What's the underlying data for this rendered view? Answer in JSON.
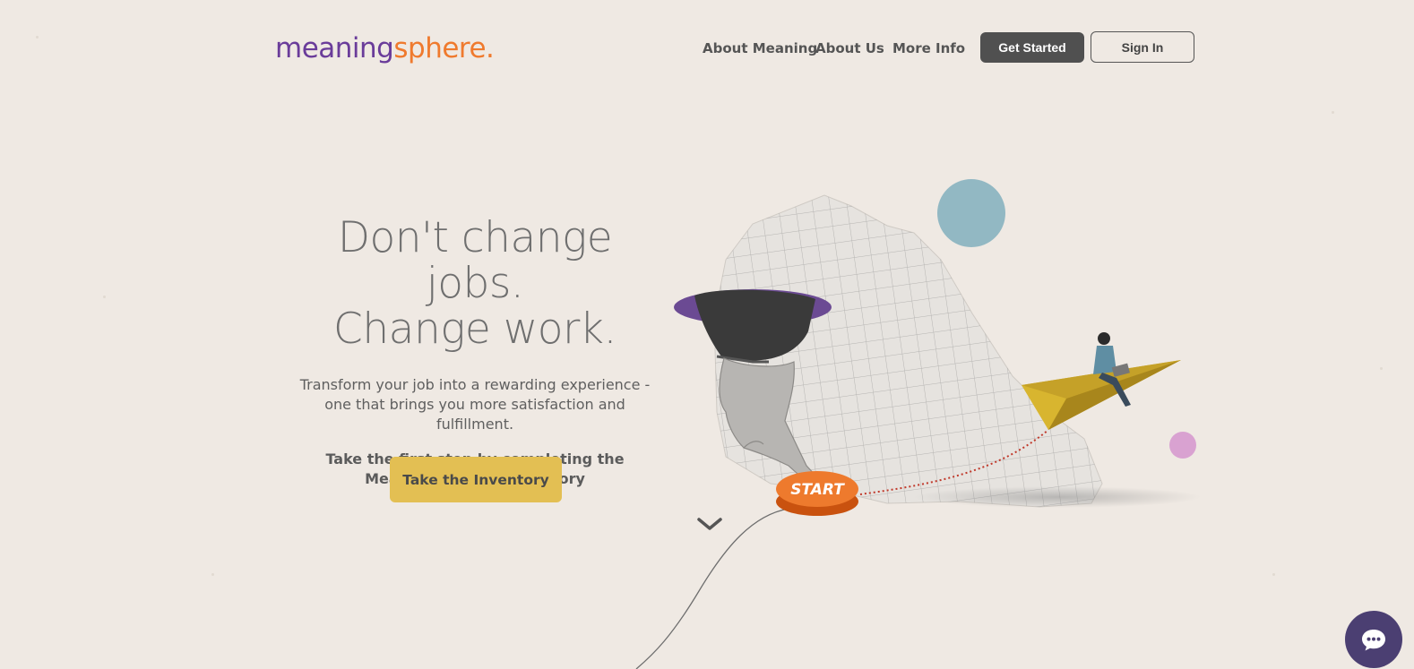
{
  "header": {
    "logo": {
      "part1": "meaning",
      "part2": "sphere",
      "dot": "."
    },
    "nav": [
      "About Meaning",
      "About Us",
      "More Info"
    ],
    "get_started": "Get Started",
    "sign_in": "Sign In"
  },
  "hero": {
    "headline_line1": "Don't change jobs.",
    "headline_line2": "Change work.",
    "subtitle": "Transform your job into a rewarding experience - one that brings you more satisfaction and fulfillment.",
    "cta_text": "Take the first step by completing the Meaningful Work Inventory",
    "cta_button": "Take the Inventory"
  },
  "illustration": {
    "button_label": "START"
  },
  "icons": {
    "scroll": "chevron-down-icon",
    "chat": "chat-icon"
  },
  "colors": {
    "background": "#efe9e3",
    "brand_purple": "#6a3c9a",
    "brand_orange": "#ef7a2e",
    "cta_yellow": "#e3bf53",
    "chat_bubble": "#4b3f72"
  }
}
